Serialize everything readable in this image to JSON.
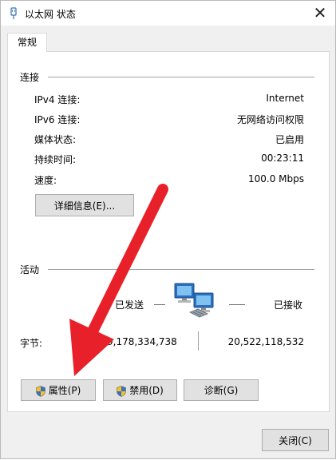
{
  "window": {
    "title": "以太网 状态",
    "close_glyph": "✕"
  },
  "tabs": [
    {
      "label": "常规",
      "active": true
    }
  ],
  "connection": {
    "group_label": "连接",
    "rows": [
      {
        "label": "IPv4 连接:",
        "value": "Internet"
      },
      {
        "label": "IPv6 连接:",
        "value": "无网络访问权限"
      },
      {
        "label": "媒体状态:",
        "value": "已启用"
      },
      {
        "label": "持续时间:",
        "value": "00:23:11"
      },
      {
        "label": "速度:",
        "value": "100.0 Mbps"
      }
    ],
    "details_button": "详细信息(E)..."
  },
  "activity": {
    "group_label": "活动",
    "sent_label": "已发送",
    "received_label": "已接收",
    "bytes_label": "字节:",
    "bytes_sent": "9,178,334,738",
    "bytes_received": "20,522,118,532"
  },
  "buttons": {
    "properties": "属性(P)",
    "disable": "禁用(D)",
    "diagnose": "诊断(G)",
    "close": "关闭(C)"
  },
  "colors": {
    "arrow": "#e8202a",
    "panel_bg": "#ffffff",
    "client_bg": "#f0f0f0",
    "button_bg": "#e1e1e1"
  }
}
